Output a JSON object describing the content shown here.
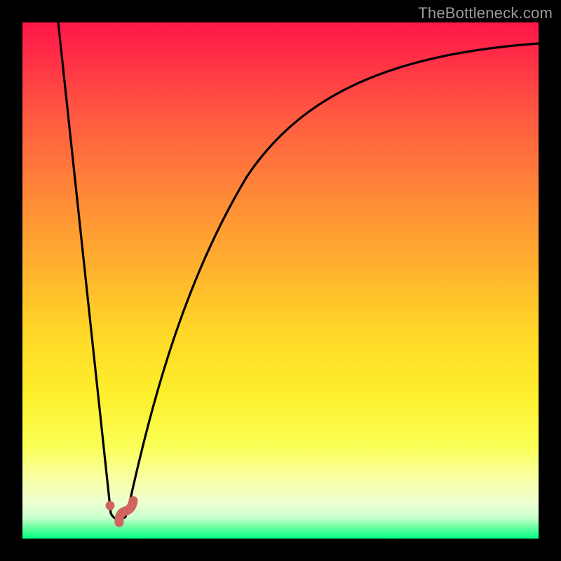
{
  "watermark": {
    "text": "TheBottleneck.com"
  },
  "colors": {
    "frame": "#000000",
    "gradient_top": "#ff1649",
    "gradient_mid": "#ffe126",
    "gradient_bottom": "#00ff85",
    "curve": "#000000",
    "marker": "#d1645f"
  },
  "chart_data": {
    "type": "line",
    "title": "",
    "xlabel": "",
    "ylabel": "",
    "xlim": [
      0,
      100
    ],
    "ylim": [
      0,
      100
    ],
    "series": [
      {
        "name": "v-line-down",
        "x": [
          7,
          17
        ],
        "y": [
          100,
          5
        ]
      },
      {
        "name": "v-floor",
        "x": [
          17,
          20
        ],
        "y": [
          5,
          4
        ]
      },
      {
        "name": "rising-curve",
        "x": [
          20,
          22,
          24,
          26,
          28,
          30,
          33,
          36,
          40,
          45,
          50,
          56,
          63,
          72,
          82,
          92,
          100
        ],
        "y": [
          4,
          11,
          20,
          28,
          36,
          43,
          51,
          58,
          65,
          72,
          77,
          82,
          86,
          90,
          93,
          95,
          96
        ]
      }
    ],
    "markers": [
      {
        "name": "dot",
        "x": 17.2,
        "y": 6.8
      },
      {
        "name": "hook-tip",
        "x": 20.5,
        "y": 4.1
      }
    ],
    "grid": false,
    "legend": false
  }
}
